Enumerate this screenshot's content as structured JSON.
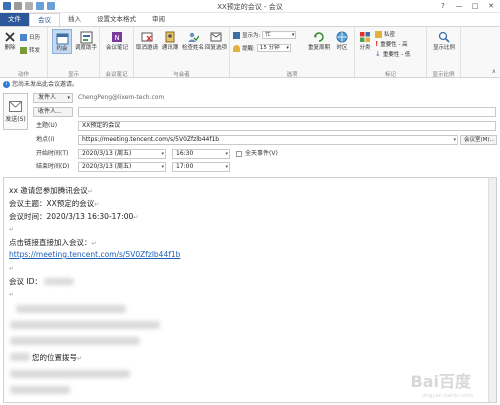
{
  "window": {
    "title": "XX预定的会议 - 会议",
    "controls": [
      "?",
      "—",
      "□",
      "✕"
    ]
  },
  "tabs": [
    {
      "label": "文件"
    },
    {
      "label": "会议"
    },
    {
      "label": "插入"
    },
    {
      "label": "设置文本格式"
    },
    {
      "label": "审阅"
    }
  ],
  "ribbon": {
    "actions": {
      "delete": "删除",
      "calendar": "日历",
      "forward": "转发",
      "group": "动作"
    },
    "show": {
      "appointment": "约会",
      "scheduling": "调度助手",
      "group": "显示"
    },
    "notes": {
      "meeting_notes": "会议笔记",
      "group": "会议笔记"
    },
    "attendees": {
      "cancel": "取消邀请",
      "address_book": "通讯簿",
      "check_names": "检查姓名",
      "response": "回复选项",
      "group": "与会者"
    },
    "options": {
      "show_as_label": "显示为:",
      "show_as_value": "忙",
      "reminder_label": "提醒:",
      "reminder_value": "15 分钟",
      "recurrence": "重复周期",
      "timezone": "时区",
      "group": "选项"
    },
    "tags": {
      "categorize": "分类",
      "private": "私密",
      "high": "重要性 - 高",
      "low": "重要性 - 低",
      "group": "标记"
    },
    "zoom": {
      "label": "显示比例",
      "group": "显示比例"
    }
  },
  "infobar": {
    "text": "您尚未发出此会议邀请。"
  },
  "form": {
    "send_label": "发送(S)",
    "from_button": "发件人",
    "from_value": "ChengPeng@lixem-tech.com",
    "to_button": "收件人...",
    "subject_label": "主题(U)",
    "subject_value": "XX预定的会议",
    "location_label": "地点(I)",
    "location_value": "https://meeting.tencent.com/s/5V0Zfzlb44f1b",
    "rooms_button": "会议室(M)...",
    "start_label": "开始时间(T)",
    "start_date": "2020/3/13 (周五)",
    "start_time": "16:30",
    "allday_label": "全天事件(V)",
    "end_label": "结束时间(D)",
    "end_date": "2020/3/13 (周五)",
    "end_time": "17:00"
  },
  "body": {
    "line1": "xx 邀请您参加腾讯会议",
    "line2": "会议主题：XX预定的会议",
    "line3": "会议时间：2020/3/13 16:30-17:00",
    "line4": "点击链接直接加入会议：",
    "link": "https://meeting.tencent.com/s/5V0Zfzlb44f1b",
    "line5": "会议 ID：",
    "line6": "您的位置拨号",
    "return_mark": "↵",
    "watermark": "Bai百度",
    "watermark_sub": "jingyan.baidu.com"
  },
  "colors": {
    "file_tab": "#2b579a",
    "accent": "#2b579a",
    "link": "#1f5fb8"
  }
}
